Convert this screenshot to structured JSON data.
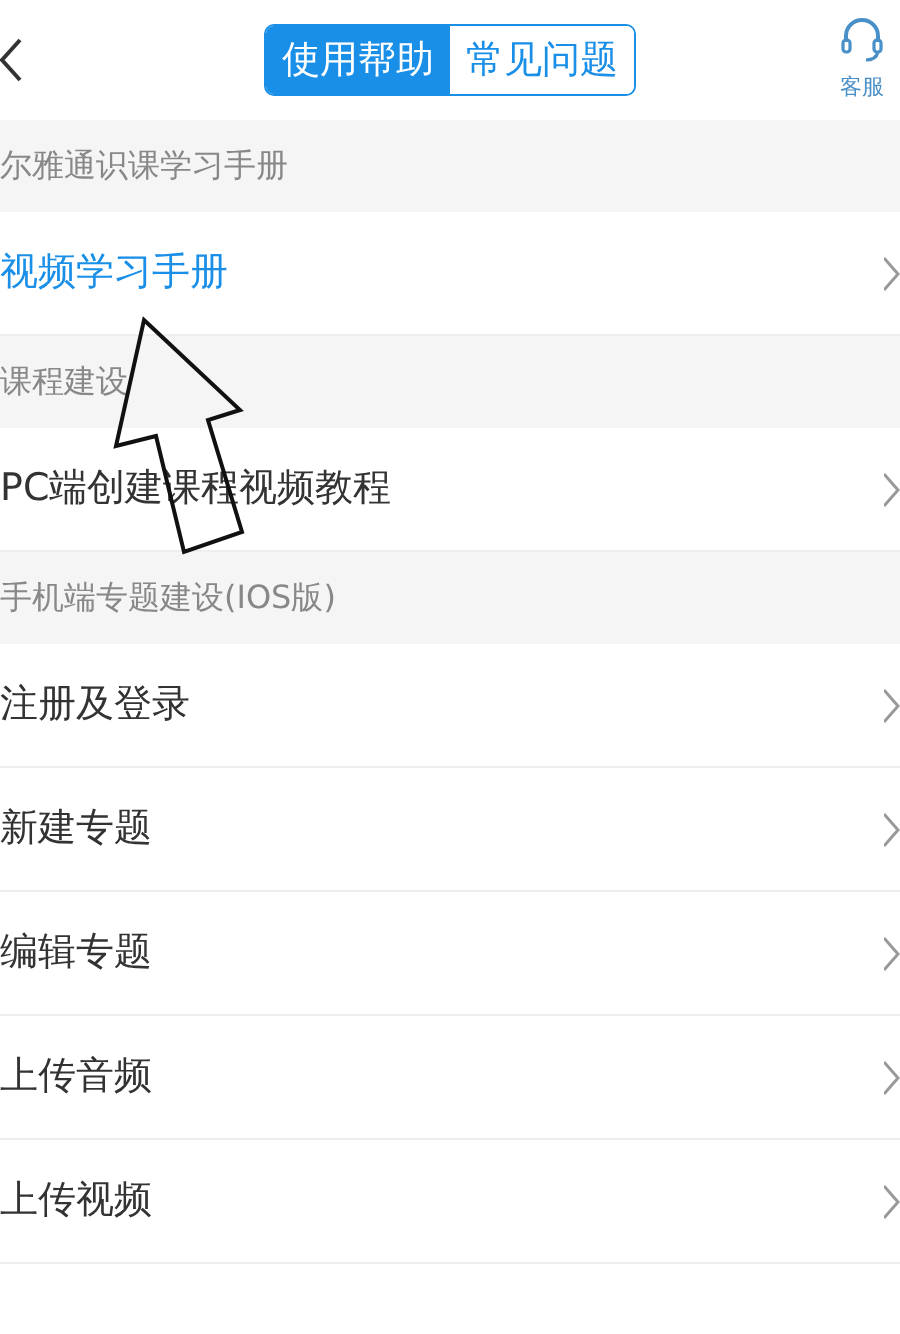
{
  "header": {
    "tabs": [
      {
        "label": "使用帮助",
        "selected": true
      },
      {
        "label": "常见问题",
        "selected": false
      }
    ],
    "service": {
      "label": "客服"
    }
  },
  "sections": [
    {
      "title": "尔雅通识课学习手册",
      "items": [
        {
          "label": "视频学习手册",
          "selected": true
        }
      ]
    },
    {
      "title": "课程建设",
      "items": [
        {
          "label": "PC端创建课程视频教程",
          "selected": false
        }
      ]
    },
    {
      "title": "手机端专题建设(IOS版)",
      "items": [
        {
          "label": "注册及登录",
          "selected": false
        },
        {
          "label": "新建专题",
          "selected": false
        },
        {
          "label": "编辑专题",
          "selected": false
        },
        {
          "label": "上传音频",
          "selected": false
        },
        {
          "label": "上传视频",
          "selected": false
        }
      ]
    }
  ]
}
